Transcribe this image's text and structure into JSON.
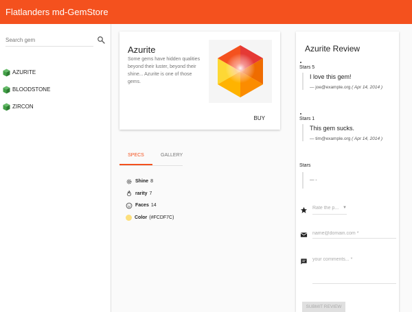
{
  "app": {
    "title": "Flatlanders md-GemStore"
  },
  "sidebar": {
    "search": {
      "placeholder": "Search gem",
      "value": ""
    },
    "gems": [
      {
        "label": "AZURITE"
      },
      {
        "label": "BLOODSTONE"
      },
      {
        "label": "ZIRCON"
      }
    ],
    "gem_icon_color": "#43a047"
  },
  "product": {
    "name": "Azurite",
    "description": "Some gems have hidden qualities beyond their luster, beyond their shine... Azurite is one of those gems.",
    "buy_label": "BUY",
    "image_icon": "hexagon-gem-image"
  },
  "tabs": [
    {
      "label": "SPECS",
      "active": true
    },
    {
      "label": "GALLERY",
      "active": false
    }
  ],
  "specs": [
    {
      "icon": "gear-icon",
      "name": "Shine",
      "value": "8"
    },
    {
      "icon": "fire-icon",
      "name": "rarity",
      "value": "7"
    },
    {
      "icon": "smile-icon",
      "name": "Faces",
      "value": "14"
    },
    {
      "icon": "color-dot",
      "name": "Color",
      "value": "(#FCDF7C)"
    }
  ],
  "spec_color": "#FCDF7C",
  "reviews": {
    "title": "Azurite Review",
    "items": [
      {
        "stars_label": "Stars 5",
        "body": "I love this gem!",
        "author": "— joe@example.org",
        "date": "( Apr 14, 2014 )"
      },
      {
        "stars_label": "Stars 1",
        "body": "This gem sucks.",
        "author": "— tim@example.org",
        "date": "( Apr 14, 2014 )"
      },
      {
        "stars_label": "Stars",
        "body": "",
        "author": "—",
        "date": "-"
      }
    ],
    "form": {
      "rating_placeholder": "Rate the p...",
      "email_placeholder": "name@domain.com *",
      "comments_placeholder": "your comments... *",
      "submit_label": "SUBMIT REVIEW"
    }
  },
  "colors": {
    "accent": "#f4511e",
    "toolbar": "#f4511e"
  }
}
